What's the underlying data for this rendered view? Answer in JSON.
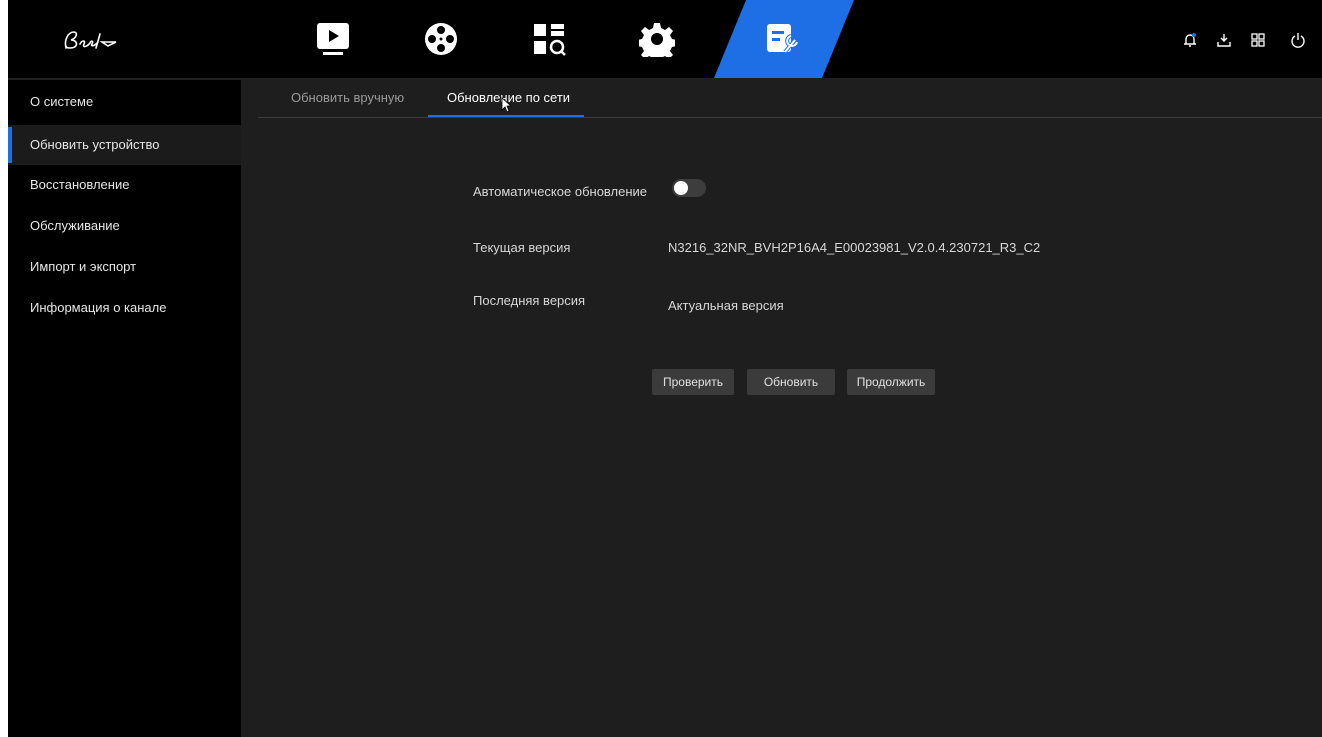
{
  "topbar": {
    "logo_icon": "bestlp-logo",
    "nav_icons": [
      "playback-icon",
      "film-reel-icon",
      "search-grid-icon",
      "gear-icon",
      "maintenance-icon"
    ],
    "active_nav": "maintenance-icon",
    "utility_icons": [
      "bell-icon",
      "download-icon",
      "grid-icon",
      "power-icon"
    ],
    "accent_color": "#1e6fe6"
  },
  "sidebar": {
    "items": [
      {
        "label": "О системе"
      },
      {
        "label": "Обновить устройство"
      },
      {
        "label": "Восстановление"
      },
      {
        "label": "Обслуживание"
      },
      {
        "label": "Импорт и экспорт"
      },
      {
        "label": "Информация о канале"
      }
    ],
    "active_index": 1
  },
  "tabs": [
    {
      "label": "Обновить вручную"
    },
    {
      "label": "Обновление по сети"
    }
  ],
  "active_tab_index": 1,
  "form": {
    "auto_update_label": "Автоматическое обновление",
    "auto_update_enabled": false,
    "current_version_label": "Текущая версия",
    "current_version_value": "N3216_32NR_BVH2P16A4_E00023981_V2.0.4.230721_R3_C2",
    "latest_version_label": "Последняя версия",
    "latest_version_value": "Актуальная версия"
  },
  "buttons": {
    "check": "Проверить",
    "update": "Обновить",
    "continue": "Продолжить"
  }
}
